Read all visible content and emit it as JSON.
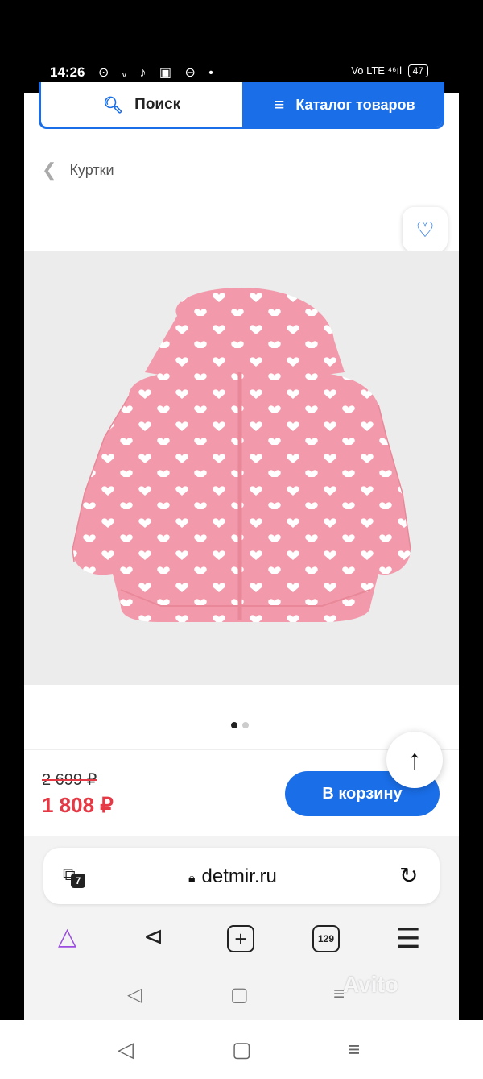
{
  "status": {
    "time": "14:26",
    "icons": "⊙ ᵥ ♪ ▣ ⊖ •",
    "signal": "Vo LTE ⁴⁶ıl",
    "battery": "47"
  },
  "header": {
    "search_label": "Поиск",
    "catalog_label": "Каталог товаров"
  },
  "breadcrumb": {
    "label": "Куртки"
  },
  "product": {
    "old_price": "2 699 ₽",
    "new_price": "1 808 ₽",
    "cart_label": "В корзину",
    "images_count": 2,
    "active_image": 1
  },
  "browser": {
    "url": "detmir.ru",
    "open_tabs_badge": "7",
    "tabs_count": "129"
  },
  "watermark": "Avito",
  "colors": {
    "accent": "#1a6ee8",
    "price": "#e63946",
    "product_pink": "#f29aab"
  }
}
